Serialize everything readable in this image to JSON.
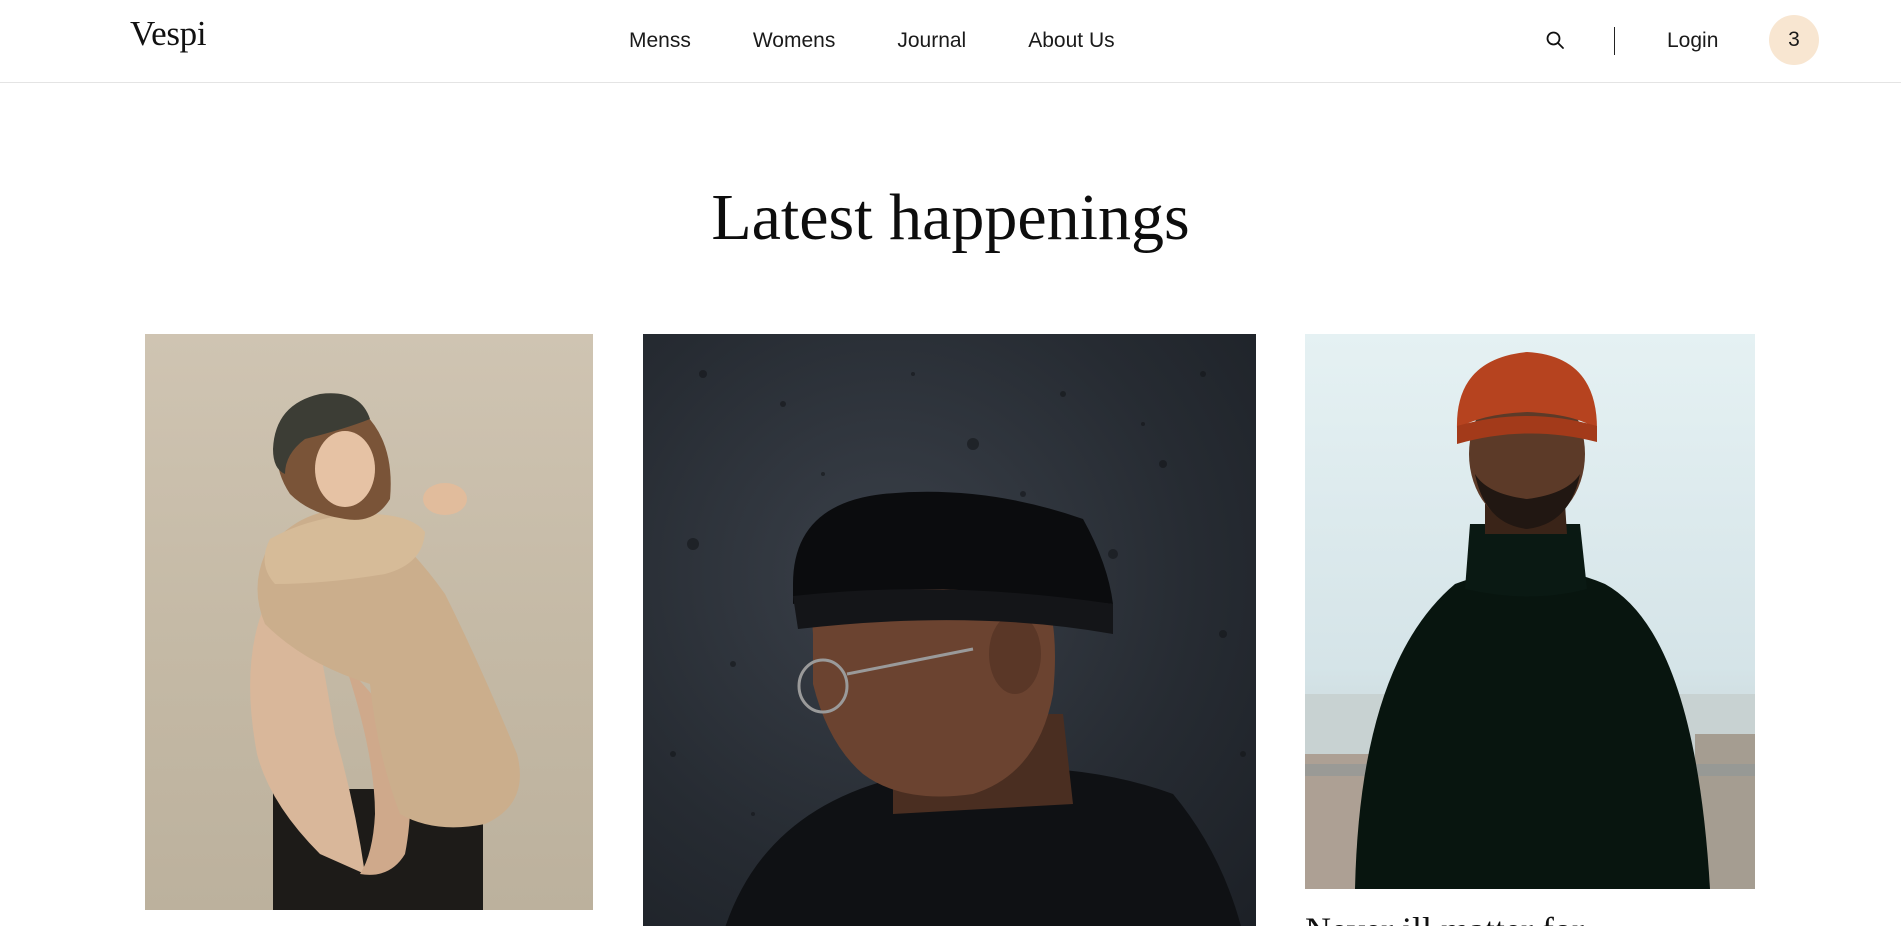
{
  "header": {
    "logo": "Vespi",
    "nav": [
      "Menss",
      "Womens",
      "Journal",
      "About Us"
    ],
    "search_icon": "search-icon",
    "login_label": "Login",
    "cart_count": "3",
    "cart_badge_color": "#f8e6d1"
  },
  "main": {
    "title": "Latest happenings",
    "cards": [
      {
        "image": "woman-beige-sweater-cap-photo"
      },
      {
        "image": "man-black-beanie-glasses-photo"
      },
      {
        "image": "man-orange-beanie-turtleneck-photo",
        "title": "Never ill matter for"
      }
    ]
  }
}
